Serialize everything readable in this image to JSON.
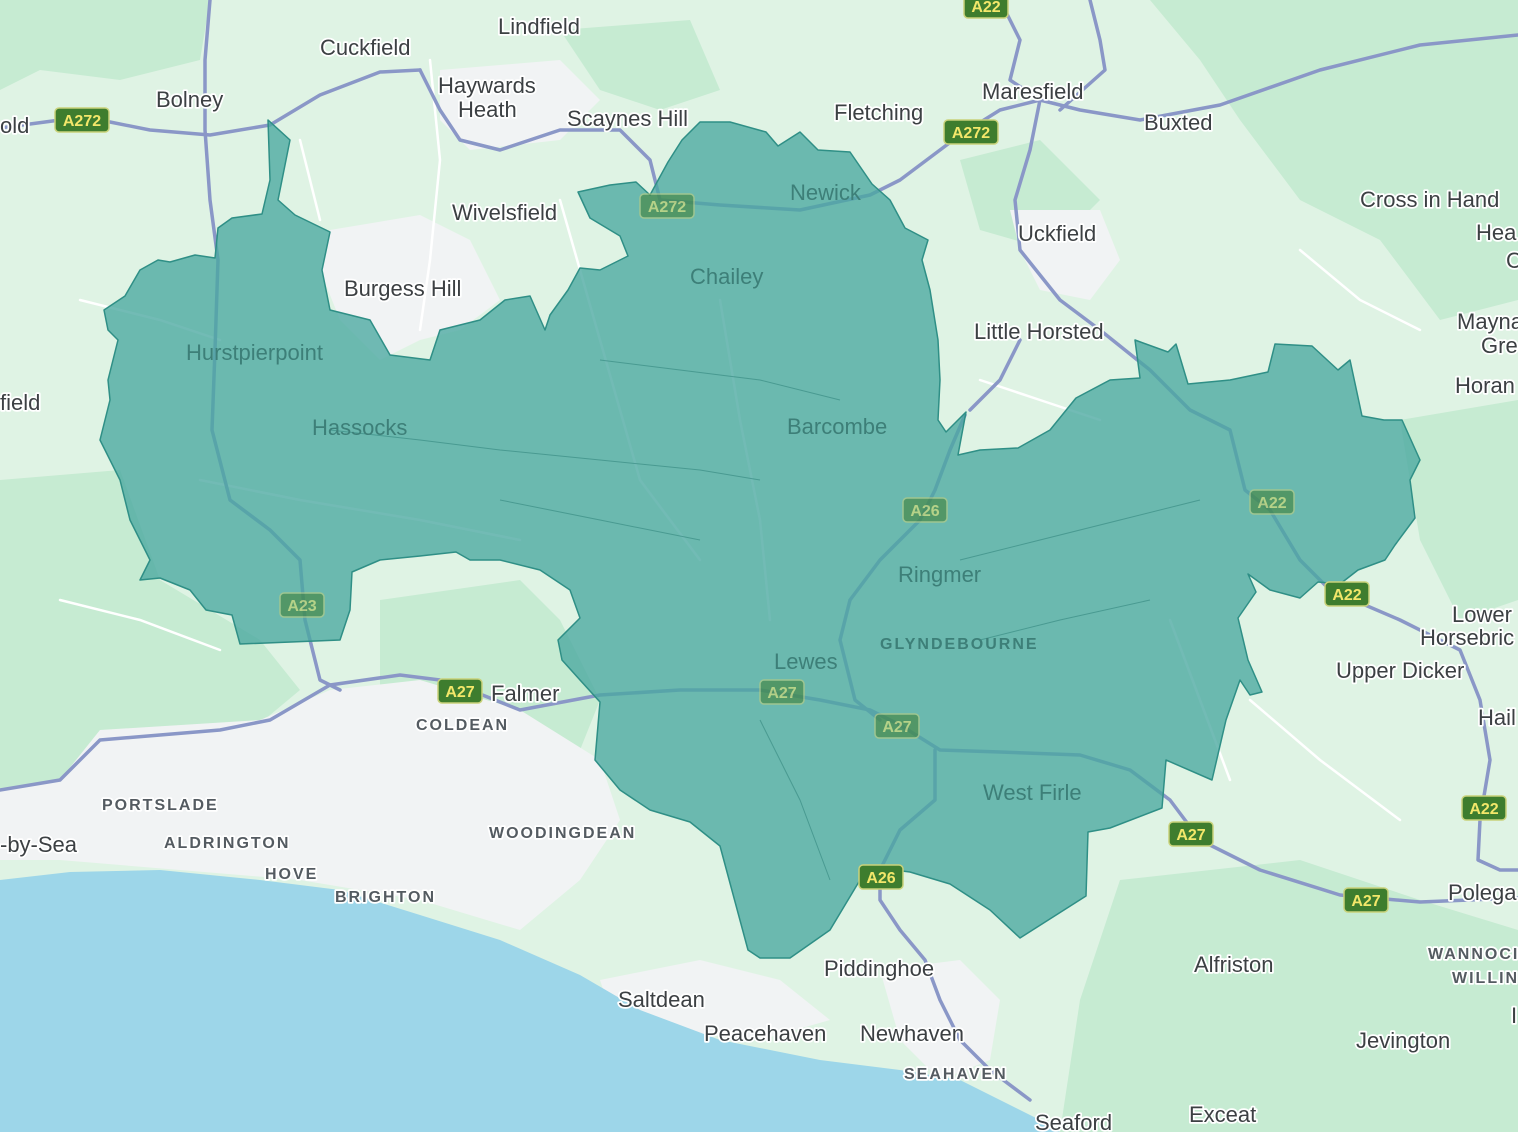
{
  "colors": {
    "land": "#dff3e4",
    "woodland": "#c6ebd2",
    "sea": "#9dd6e9",
    "urban": "#f1f3f4",
    "roads_minor": "#ffffff",
    "roads_major": "#8a97c7",
    "region_fill": "#4aa8a0",
    "region_stroke": "#2f8f86",
    "shield_fill": "#3e7d2e",
    "shield_text": "#f3e76a"
  },
  "region": {
    "label": "highlighted area (teal)"
  },
  "places": [
    {
      "name": "Lindfield"
    },
    {
      "name": "Cuckfield"
    },
    {
      "name": "Haywards"
    },
    {
      "name": "Heath"
    },
    {
      "name": "Bolney"
    },
    {
      "name": "old"
    },
    {
      "name": "Scaynes Hill"
    },
    {
      "name": "Fletching"
    },
    {
      "name": "Maresfield"
    },
    {
      "name": "Buxted"
    },
    {
      "name": "Newick"
    },
    {
      "name": "Wivelsfield"
    },
    {
      "name": "Uckfield"
    },
    {
      "name": "Cross in Hand"
    },
    {
      "name": "Hea"
    },
    {
      "name": "C"
    },
    {
      "name": "Chailey"
    },
    {
      "name": "Burgess Hill"
    },
    {
      "name": "Little Horsted"
    },
    {
      "name": "Mayna"
    },
    {
      "name": "Gre"
    },
    {
      "name": "Hurstpierpoint"
    },
    {
      "name": "Horan"
    },
    {
      "name": "field"
    },
    {
      "name": "Hassocks"
    },
    {
      "name": "Barcombe"
    },
    {
      "name": "Ringmer"
    },
    {
      "name": "Lower"
    },
    {
      "name": "Horsebric"
    },
    {
      "name": "Upper Dicker"
    },
    {
      "name": "Lewes"
    },
    {
      "name": "Falmer"
    },
    {
      "name": "Hail"
    },
    {
      "name": "West Firle"
    },
    {
      "name": "-by-Sea"
    },
    {
      "name": "Polega"
    },
    {
      "name": "Piddinghoe"
    },
    {
      "name": "Alfriston"
    },
    {
      "name": "Saltdean"
    },
    {
      "name": "Peacehaven"
    },
    {
      "name": "Newhaven"
    },
    {
      "name": "Jevington"
    },
    {
      "name": "Seaford"
    },
    {
      "name": "Exceat"
    },
    {
      "name": "I"
    }
  ],
  "districts": [
    {
      "name": "GLYNDEBOURNE"
    },
    {
      "name": "COLDEAN"
    },
    {
      "name": "PORTSLADE"
    },
    {
      "name": "ALDRINGTON"
    },
    {
      "name": "HOVE"
    },
    {
      "name": "BRIGHTON"
    },
    {
      "name": "WOODINGDEAN"
    },
    {
      "name": "SEAHAVEN"
    },
    {
      "name": "WANNOCI"
    },
    {
      "name": "WILLIN"
    }
  ],
  "road_shields": [
    {
      "label": "A22"
    },
    {
      "label": "A272"
    },
    {
      "label": "A272"
    },
    {
      "label": "A272"
    },
    {
      "label": "A26"
    },
    {
      "label": "A22"
    },
    {
      "label": "A22"
    },
    {
      "label": "A23"
    },
    {
      "label": "A27"
    },
    {
      "label": "A27"
    },
    {
      "label": "A27"
    },
    {
      "label": "A27"
    },
    {
      "label": "A26"
    },
    {
      "label": "A27"
    },
    {
      "label": "A22"
    }
  ]
}
